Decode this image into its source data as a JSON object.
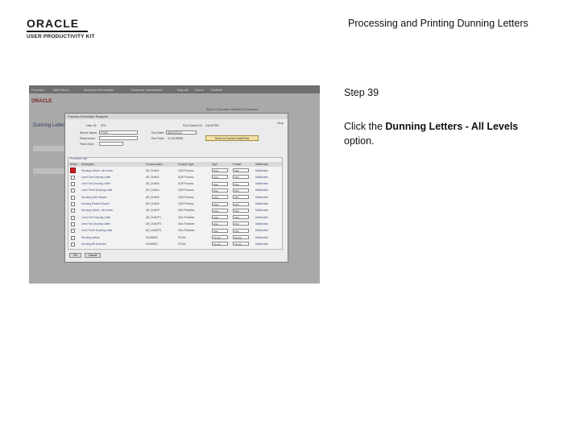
{
  "header": {
    "logo_brand": "ORACLE",
    "logo_sub": "USER PRODUCTIVITY KIT",
    "title": "Processing and Printing Dunning Letters"
  },
  "instruction": {
    "step": "Step 39",
    "prefix": "Click the ",
    "target": "Dunning Letters - All Levels",
    "suffix": " option."
  },
  "screenshot": {
    "menubar": [
      "Favorites",
      "Main Menu",
      "Accounts Receivable",
      "Customer Interactions",
      "Reports",
      "Home",
      "Worklist"
    ],
    "app_logo": "ORACLE",
    "app_links": "Add to Favorites   Worklist   Processes",
    "bg_title": "Dunning Letters",
    "modal": {
      "title": "Process Scheduler Request",
      "help": "Help",
      "user_id_label": "User ID:",
      "user_id": "VP1",
      "run_control_label": "Run Control ID:",
      "run_control": "DUNLTRS",
      "server_label": "Server Name:",
      "server_value": "PSNT",
      "recurrence_label": "Recurrence:",
      "timezone_label": "Time Zone:",
      "run_date_label": "Run Date:",
      "run_date": "08/23/2012",
      "run_time_label": "Run Time:",
      "run_time": "11:03:59PM",
      "reset_btn": "Reset to Current Date/Time",
      "process_list_title": "Process List",
      "columns": [
        "Select",
        "Description",
        "Process Name",
        "Process Type",
        "Type",
        "Format",
        "Distribution"
      ],
      "rows": [
        {
          "desc": "Dunning Letters - All Levels",
          "name": "AR_DUN01",
          "ptype": "SQR Process",
          "type": "Web",
          "format": "PDF",
          "dist": "Distribution",
          "selected": true
        },
        {
          "desc": "Level One Dunning Letter",
          "name": "AR_DUN02",
          "ptype": "SQR Process",
          "type": "Web",
          "format": "PDF",
          "dist": "Distribution",
          "selected": false
        },
        {
          "desc": "Level Two Dunning Letter",
          "name": "AR_DUN03",
          "ptype": "SQR Process",
          "type": "Web",
          "format": "PDF",
          "dist": "Distribution",
          "selected": false
        },
        {
          "desc": "Level Three Dunning Letter",
          "name": "AR_DUN04",
          "ptype": "SQR Process",
          "type": "Web",
          "format": "PDF",
          "dist": "Distribution",
          "selected": false
        },
        {
          "desc": "Dunning Letter Report",
          "name": "AR_DUN05",
          "ptype": "SQR Process",
          "type": "Web",
          "format": "PDF",
          "dist": "Distribution",
          "selected": false
        },
        {
          "desc": "Dunning Preview Report",
          "name": "AR_DUN06",
          "ptype": "SQR Process",
          "type": "Web",
          "format": "PDF",
          "dist": "Distribution",
          "selected": false
        },
        {
          "desc": "Dunning Letters - All Levels",
          "name": "AR_DUNXP",
          "ptype": "XML Publisher",
          "type": "Web",
          "format": "PDF",
          "dist": "Distribution",
          "selected": false
        },
        {
          "desc": "Level One Dunning Letter",
          "name": "AR_DUNXP1",
          "ptype": "XML Publisher",
          "type": "Web",
          "format": "PDF",
          "dist": "Distribution",
          "selected": false
        },
        {
          "desc": "Level Two Dunning Letter",
          "name": "AR_DUNXP2",
          "ptype": "XML Publisher",
          "type": "Web",
          "format": "PDF",
          "dist": "Distribution",
          "selected": false
        },
        {
          "desc": "Level Three Dunning Letter",
          "name": "AR_DUNXP3",
          "ptype": "XML Publisher",
          "type": "Web",
          "format": "PDF",
          "dist": "Distribution",
          "selected": false
        },
        {
          "desc": "Dunning Letters",
          "name": "DUNNING",
          "ptype": "PSJob",
          "type": "(None)",
          "format": "(None)",
          "dist": "Distribution",
          "selected": false
        },
        {
          "desc": "Dunning Re-Selection",
          "name": "DUNNSEL",
          "ptype": "PSJob",
          "type": "(None)",
          "format": "(None)",
          "dist": "Distribution",
          "selected": false
        }
      ],
      "ok": "OK",
      "cancel": "Cancel"
    }
  }
}
